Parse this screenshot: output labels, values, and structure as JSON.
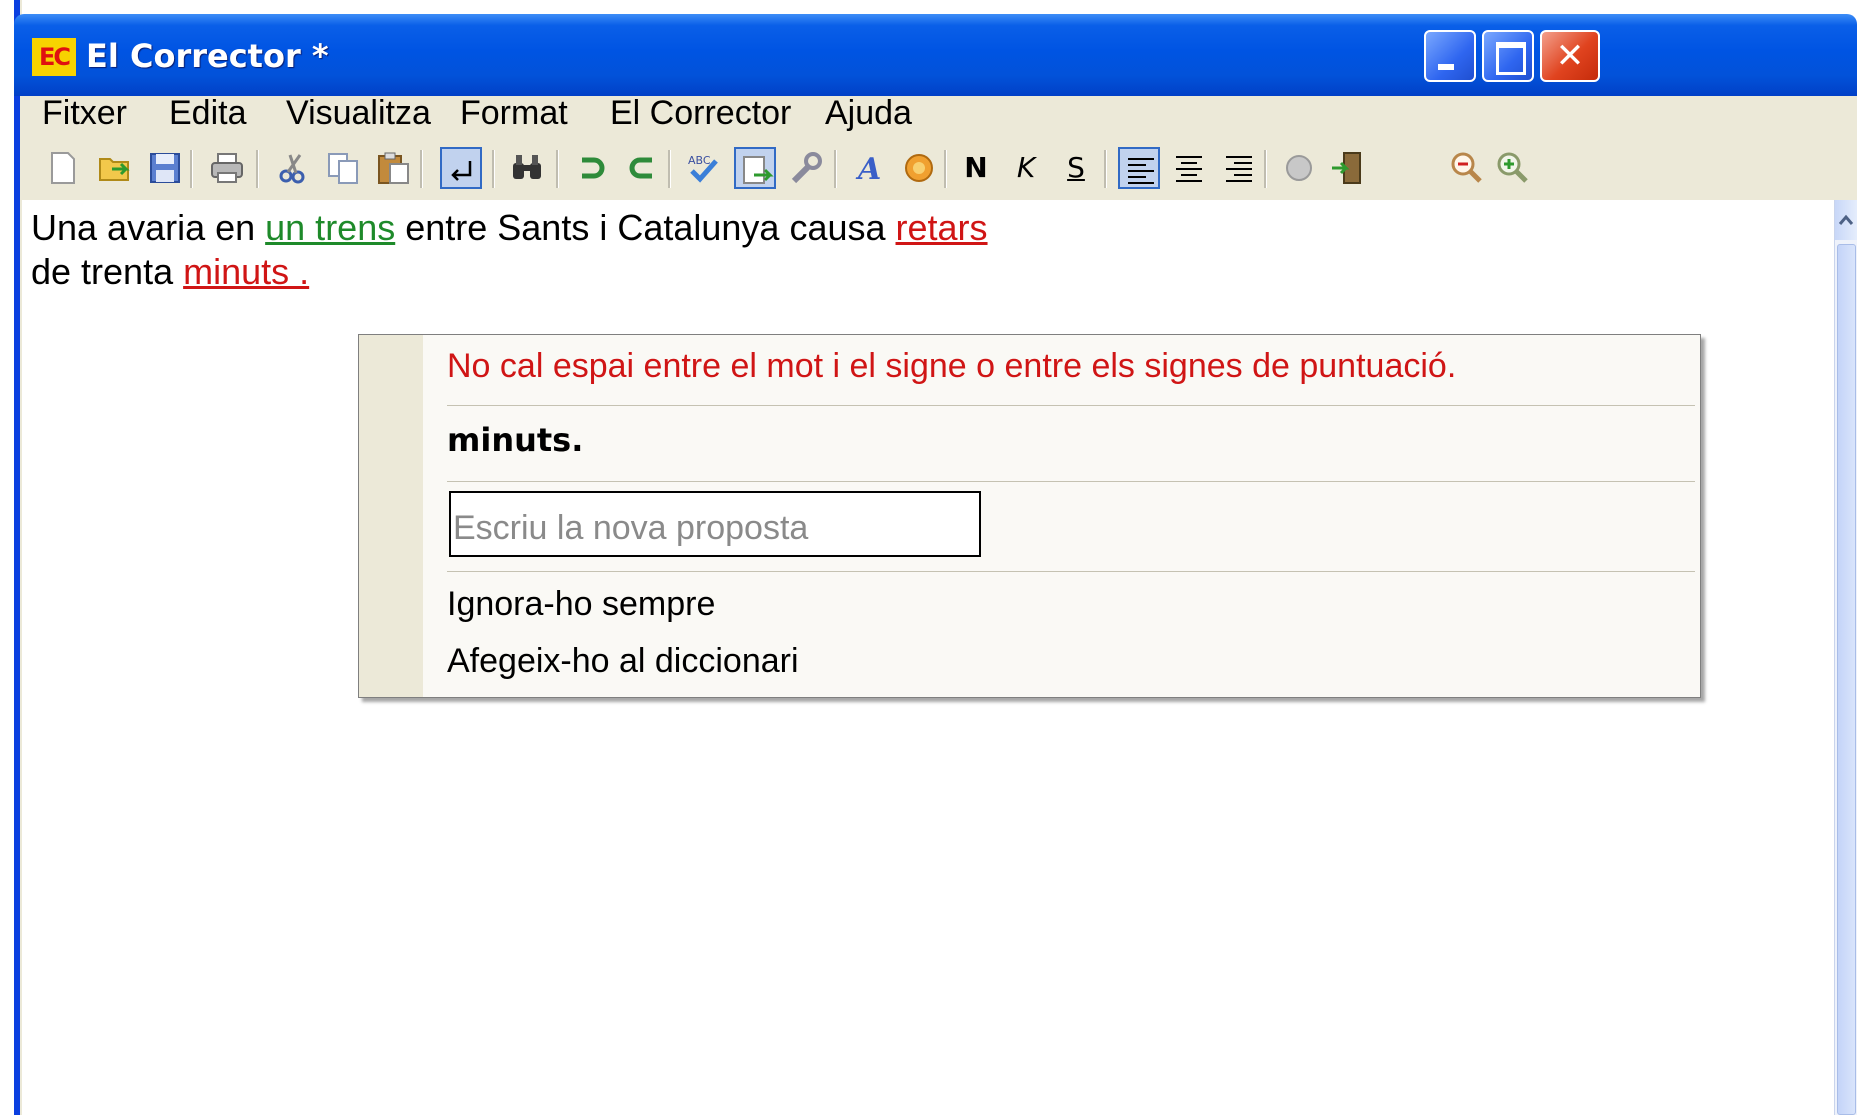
{
  "window": {
    "logo": "EC",
    "title": "El Corrector *",
    "controls": [
      "minimize-icon",
      "maximize-icon",
      "close-icon"
    ]
  },
  "menu": [
    "Fitxer",
    "Edita",
    "Visualitza",
    "Format",
    "El Corrector",
    "Ajuda"
  ],
  "toolbar": {
    "bold_label": "N",
    "italic_label": "K",
    "underline_label": "S",
    "icons": [
      "new-document-icon",
      "open-icon",
      "save-icon",
      "print-icon",
      "cut-icon",
      "copy-icon",
      "paste-icon",
      "paragraph-mark-icon",
      "find-icon",
      "undo-icon",
      "redo-icon",
      "spellcheck-icon",
      "export-icon",
      "tools-icon",
      "font-icon",
      "color-icon",
      "bold-icon",
      "italic-icon",
      "underline-icon",
      "align-left-icon",
      "align-center-icon",
      "align-right-icon",
      "help-icon",
      "exit-icon",
      "zoom-out-icon",
      "zoom-in-icon"
    ]
  },
  "document": {
    "line1": {
      "t1": "Una avaria en ",
      "e1": "un trens",
      "t2": " entre Sants i Catalunya causa ",
      "e2": "retars"
    },
    "line2": {
      "t1": "de trenta ",
      "e1": "minuts ."
    }
  },
  "popup": {
    "message": "No cal espai entre el mot i el signe o entre els signes de puntuació.",
    "suggestion": "minuts.",
    "input_placeholder": "Escriu la nova proposta",
    "ignore_always": "Ignora-ho sempre",
    "add_to_dictionary": "Afegeix-ho al diccionari"
  },
  "colors": {
    "grammar_error": "#1e8a2a",
    "spelling_error": "#d01515",
    "titlebar": "#0054e3"
  }
}
